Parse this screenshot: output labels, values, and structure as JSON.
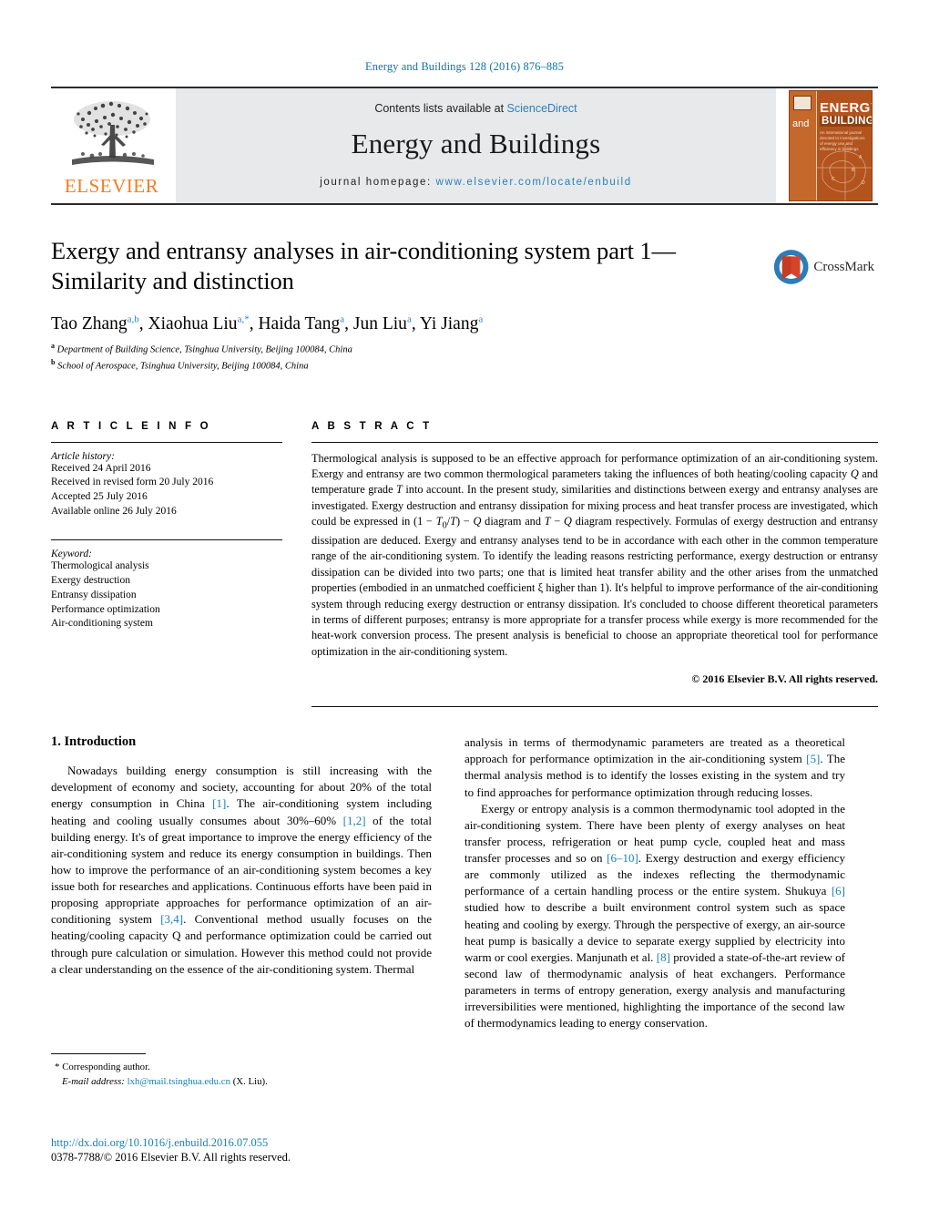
{
  "running_head": "Energy and Buildings 128 (2016) 876–885",
  "masthead": {
    "contents_prefix": "Contents lists available at ",
    "sciencedirect": "ScienceDirect",
    "journal_title": "Energy and Buildings",
    "homepage_label": "journal homepage:",
    "homepage_url": "www.elsevier.com/locate/enbuild",
    "publisher_wordmark": "ELSEVIER",
    "cover": {
      "and": "and",
      "energy": "ENERGY",
      "buildings": "BUILDINGS",
      "subtitle": "An international journal devoted to investigations of energy use and efficiency in buildings"
    }
  },
  "article": {
    "title": "Exergy and entransy analyses in air-conditioning system part 1—Similarity and distinction",
    "crossmark_label": "CrossMark",
    "authors": [
      {
        "name": "Tao Zhang",
        "sup": "a,b"
      },
      {
        "name": "Xiaohua Liu",
        "sup": "a,*"
      },
      {
        "name": "Haida Tang",
        "sup": "a"
      },
      {
        "name": "Jun Liu",
        "sup": "a"
      },
      {
        "name": "Yi Jiang",
        "sup": "a"
      }
    ],
    "affiliations": [
      {
        "marker": "a",
        "text": "Department of Building Science, Tsinghua University, Beijing 100084, China"
      },
      {
        "marker": "b",
        "text": "School of Aerospace, Tsinghua University, Beijing 100084, China"
      }
    ]
  },
  "article_info": {
    "heading": "A R T I C L E   I N F O",
    "history_label": "Article history:",
    "history": [
      "Received 24 April 2016",
      "Received in revised form 20 July 2016",
      "Accepted 25 July 2016",
      "Available online 26 July 2016"
    ],
    "keyword_label": "Keyword:",
    "keywords": [
      "Thermological analysis",
      "Exergy destruction",
      "Entransy dissipation",
      "Performance optimization",
      "Air-conditioning system"
    ]
  },
  "abstract": {
    "heading": "A B S T R A C T",
    "text": "Thermological analysis is supposed to be an effective approach for performance optimization of an air-conditioning system. Exergy and entransy are two common thermological parameters taking the influences of both heating/cooling capacity Q and temperature grade T into account. In the present study, similarities and distinctions between exergy and entransy analyses are investigated. Exergy destruction and entransy dissipation for mixing process and heat transfer process are investigated, which could be expressed in (1 − T₀/T) − Q diagram and T − Q diagram respectively. Formulas of exergy destruction and entransy dissipation are deduced. Exergy and entransy analyses tend to be in accordance with each other in the common temperature range of the air-conditioning system. To identify the leading reasons restricting performance, exergy destruction or entransy dissipation can be divided into two parts; one that is limited heat transfer ability and the other arises from the unmatched properties (embodied in an unmatched coefficient ξ higher than 1). It's helpful to improve performance of the air-conditioning system through reducing exergy destruction or entransy dissipation. It's concluded to choose different theoretical parameters in terms of different purposes; entransy is more appropriate for a transfer process while exergy is more recommended for the heat-work conversion process. The present analysis is beneficial to choose an appropriate theoretical tool for performance optimization in the air-conditioning system.",
    "copyright": "© 2016 Elsevier B.V. All rights reserved."
  },
  "body": {
    "section_title": "1. Introduction",
    "left_paragraph_1": "Nowadays building energy consumption is still increasing with the development of economy and society, accounting for about 20% of the total energy consumption in China [1]. The air-conditioning system including heating and cooling usually consumes about 30%–60% [1,2] of the total building energy. It's of great importance to improve the energy efficiency of the air-conditioning system and reduce its energy consumption in buildings. Then how to improve the performance of an air-conditioning system becomes a key issue both for researches and applications. Continuous efforts have been paid in proposing appropriate approaches for performance optimization of an air-conditioning system [3,4]. Conventional method usually focuses on the heating/cooling capacity Q and performance optimization could be carried out through pure calculation or simulation. However this method could not provide a clear understanding on the essence of the air-conditioning system. Thermal",
    "right_paragraph_1": "analysis in terms of thermodynamic parameters are treated as a theoretical approach for performance optimization in the air-conditioning system [5]. The thermal analysis method is to identify the losses existing in the system and try to find approaches for performance optimization through reducing losses.",
    "right_paragraph_2": "Exergy or entropy analysis is a common thermodynamic tool adopted in the air-conditioning system. There have been plenty of exergy analyses on heat transfer process, refrigeration or heat pump cycle, coupled heat and mass transfer processes and so on [6–10]. Exergy destruction and exergy efficiency are commonly utilized as the indexes reflecting the thermodynamic performance of a certain handling process or the entire system. Shukuya [6] studied how to describe a built environment control system such as space heating and cooling by exergy. Through the perspective of exergy, an air-source heat pump is basically a device to separate exergy supplied by electricity into warm or cool exergies. Manjunath et al. [8] provided a state-of-the-art review of second law of thermodynamic analysis of heat exchangers. Performance parameters in terms of entropy generation, exergy analysis and manufacturing irreversibilities were mentioned, highlighting the importance of the second law of thermodynamics leading to energy conservation."
  },
  "footnote": {
    "star": "*",
    "corresponding": "Corresponding author.",
    "email_label": "E-mail address:",
    "email": "lxh@mail.tsinghua.edu.cn",
    "email_owner": "(X. Liu)."
  },
  "footer": {
    "doi": "http://dx.doi.org/10.1016/j.enbuild.2016.07.055",
    "issn": "0378-7788/© 2016 Elsevier B.V. All rights reserved."
  },
  "colors": {
    "link_blue": "#1a7fb5",
    "header_blue": "#0b76a8",
    "elsevier_orange": "#F47C20",
    "band_gray": "#e8e9ea",
    "cover_orange": "#b3541e"
  }
}
